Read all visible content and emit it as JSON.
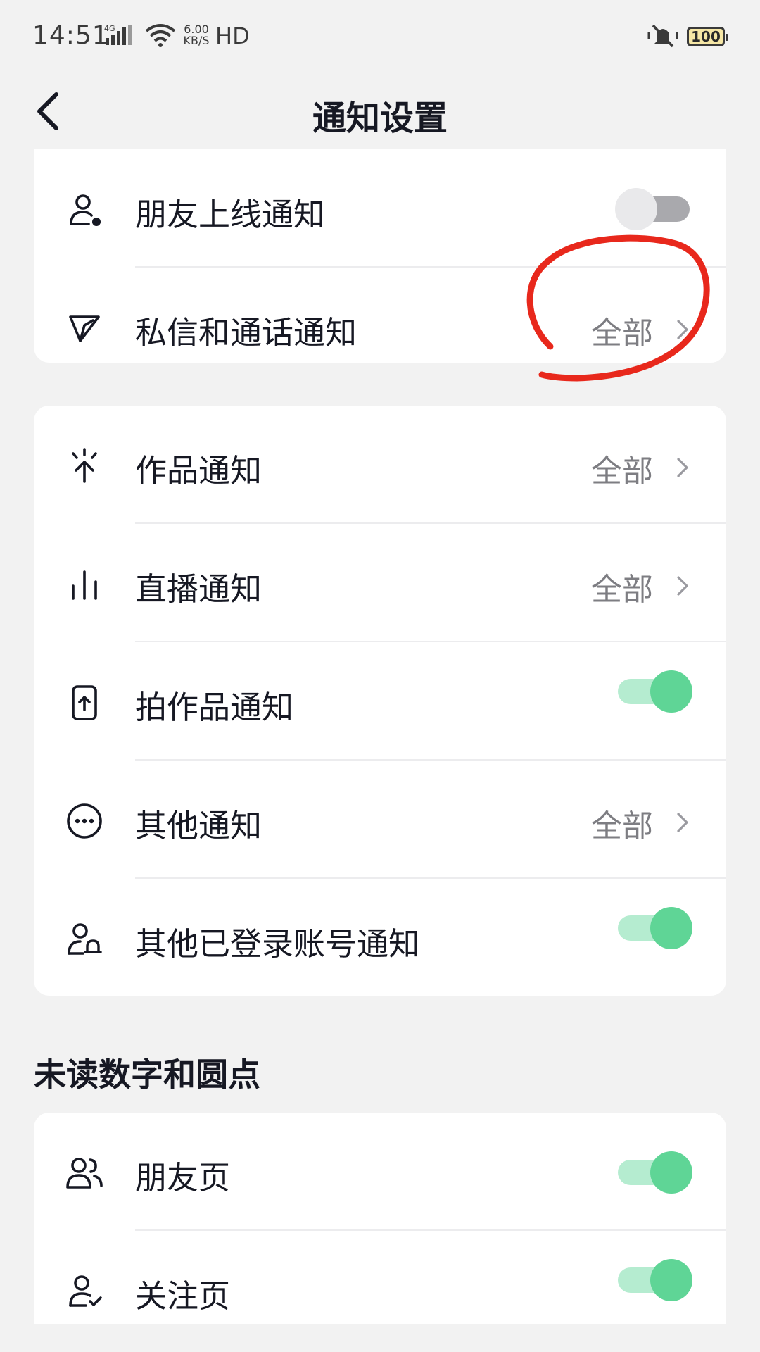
{
  "status_bar": {
    "time": "14:51",
    "network": "4G",
    "speed_value": "6.00",
    "speed_unit": "KB/S",
    "hd": "HD",
    "battery": "100"
  },
  "header": {
    "title": "通知设置"
  },
  "group1": {
    "items": [
      {
        "label": "朋友上线通知",
        "icon": "user-dot-icon",
        "toggle": false
      },
      {
        "label": "私信和通话通知",
        "icon": "paper-plane-icon",
        "value": "全部"
      }
    ]
  },
  "group2": {
    "items": [
      {
        "label": "作品通知",
        "icon": "sparkle-arrow-icon",
        "value": "全部"
      },
      {
        "label": "直播通知",
        "icon": "live-bars-icon",
        "value": "全部"
      },
      {
        "label": "拍作品通知",
        "icon": "phone-upload-icon",
        "toggle": true
      },
      {
        "label": "其他通知",
        "icon": "more-circle-icon",
        "value": "全部"
      },
      {
        "label": "其他已登录账号通知",
        "icon": "user-bell-icon",
        "toggle": true
      }
    ]
  },
  "unread_section": {
    "title": "未读数字和圆点",
    "items": [
      {
        "label": "朋友页",
        "icon": "friends-icon",
        "toggle": true
      },
      {
        "label": "关注页",
        "icon": "user-check-icon",
        "toggle": true
      }
    ]
  },
  "colors": {
    "toggle_on": "#5fd596",
    "toggle_on_track": "#b5ecd0",
    "toggle_off_track": "#a9a9ad",
    "annotation": "#e8281c"
  }
}
